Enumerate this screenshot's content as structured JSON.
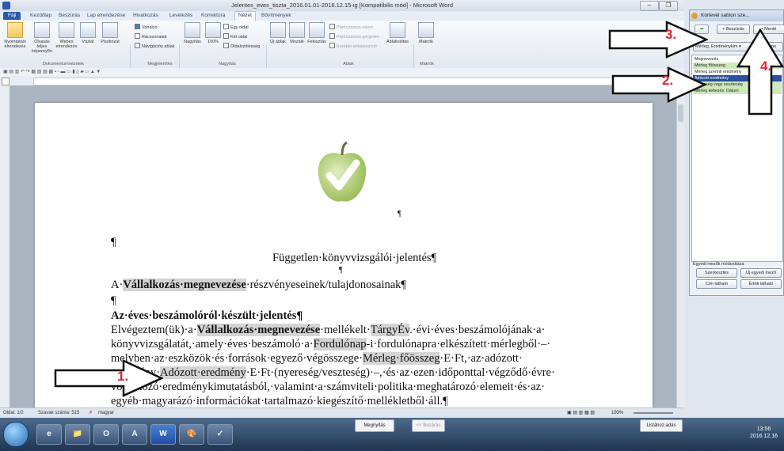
{
  "window": {
    "title": "Jelentes_eves_tiszta_2016.01.01-2016.12.15-ig [Kompatibilis mód] - Microsoft Word",
    "buttons": [
      "–",
      "❐",
      "✕"
    ]
  },
  "tabs": [
    "Fájl",
    "Kezdőlap",
    "Beszúrás",
    "Lap elrendezése",
    "Hivatkozás",
    "Levelezés",
    "Korrektúra",
    "Nézet",
    "Bővítmények"
  ],
  "active_tab": "Nézet",
  "ribbon": {
    "doc_views": [
      "Nyomtatási elrendezés",
      "Olvasás teljes képernyőn",
      "Webes elrendezés",
      "Vázlat",
      "Piszkozat"
    ],
    "doc_views_group": "Dokumentumnézetek",
    "show": [
      "Vonalzó",
      "Rácsvonalak",
      "Navigációs ablak"
    ],
    "show_group": "Megjelenítés",
    "zoom": [
      "Nagyítás",
      "100%",
      "Egy oldal",
      "Két oldal",
      "Oldalszélesség"
    ],
    "zoom_group": "Nagyítás",
    "window": [
      "Új ablak",
      "Mozaik",
      "Felosztás",
      "Párhuzamos nézet",
      "Párhuzamos görgetés",
      "Korábbi ablakpozíció",
      "Ablakváltás"
    ],
    "window_group": "Ablak",
    "macros": [
      "Makrók"
    ],
    "macros_group": "Makrók"
  },
  "document": {
    "pilcrow": "¶",
    "title": "Független·könyvvizsgálói·jelentés¶",
    "lines": [
      {
        "parts": [
          {
            "t": "A·"
          },
          {
            "t": "Vállalkozás·megnevezése",
            "hl": true,
            "b": true
          },
          {
            "t": "·részvényeseinek/tulajdonosainak¶"
          }
        ]
      },
      {
        "parts": [
          {
            "t": "¶"
          }
        ]
      },
      {
        "parts": [
          {
            "t": "Az·éves·beszámolóról·készült·jelentés¶",
            "b": true
          }
        ]
      },
      {
        "parts": [
          {
            "t": "Elvégeztem(ük)·a·"
          },
          {
            "t": "Vállalkozás·megnevezése",
            "hl": true,
            "b": true
          },
          {
            "t": "·mellékelt·"
          },
          {
            "t": "TárgyÉv",
            "hl": true
          },
          {
            "t": ".·évi·éves·beszámolójának·a·"
          }
        ]
      },
      {
        "parts": [
          {
            "t": "könyvvizsgálatát,·amely·éves·beszámoló·a·"
          },
          {
            "t": "Fordulónap",
            "hl": true
          },
          {
            "t": "-i·fordulónapra·elkészített·mérlegből·–·"
          }
        ]
      },
      {
        "parts": [
          {
            "t": "melyben·az·eszközök·és·források·egyező·végösszege·"
          },
          {
            "t": "Mérleg·főösszeg",
            "hl": true
          },
          {
            "t": "·E·Ft,·az·adózott·"
          }
        ]
      },
      {
        "parts": [
          {
            "t": "eredmény·"
          },
          {
            "t": "Adózott·eredmény",
            "hl": true
          },
          {
            "t": "·E·Ft·(nyereség/veszteség)·–,·és·az·ezen·időponttal·végződő·évre·"
          }
        ]
      },
      {
        "parts": [
          {
            "t": "vonatkozó·eredménykimutatásból,·valamint·a·számviteli·politika·meghatározó·elemeit·és·az·"
          }
        ]
      },
      {
        "parts": [
          {
            "t": "egyéb·magyarázó·információkat·tartalmazó·kiegészítő·mellékletből·áll.¶"
          }
        ]
      }
    ]
  },
  "status": {
    "page": "Oldal: 1/2",
    "words": "Szavak száma: 515",
    "lang": "magyar",
    "zoom": "193%"
  },
  "pane": {
    "title": "Körlevél sablon sze...",
    "insert_button": "Beszúrás",
    "save_button": "Menté",
    "dropdown": "Mérleg, Eredménykim",
    "dropdown_right": "Impo",
    "fields": [
      "Megnevezés",
      "Mérleg főösszeg",
      "Mérleg szerinti eredmény",
      "Adózott eredmény",
      "Nyereség vagy veszteség",
      "Mérleg keltezés: Dátum"
    ],
    "selected_field_index": 3,
    "group_label": "Egyedi mezők módosítása",
    "edit_button": "Szerkesztés",
    "new_field_button": "Új egyedi mező",
    "name_visible_button": "Cím látható",
    "value_visible_button": "Érték látható"
  },
  "taskbar": {
    "apps": [
      "e",
      "📁",
      "O",
      "A",
      "W",
      "🎨",
      "✓"
    ],
    "preview_btn": "Megnyitás",
    "preview_btn2": "<< Bezárás",
    "preview_btn3": "Listához adás",
    "time": "13:56",
    "date": "2016.12.16"
  },
  "annotations": [
    "1.",
    "2.",
    "3.",
    "4."
  ]
}
